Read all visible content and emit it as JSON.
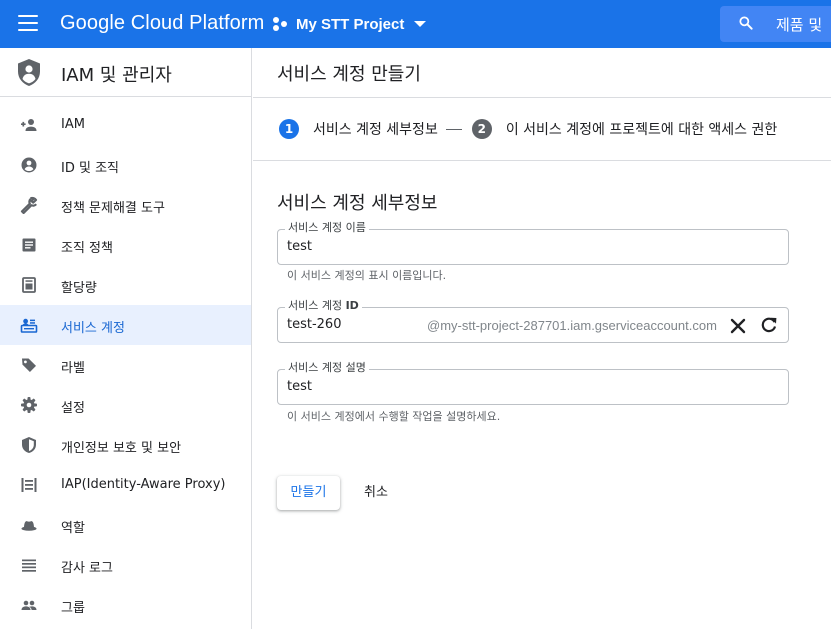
{
  "topbar": {
    "brand": "Google Cloud Platform",
    "project_name": "My STT Project",
    "search_placeholder": "제품 및"
  },
  "sidebar": {
    "title": "IAM 및 관리자",
    "items": [
      {
        "label": "IAM",
        "icon": "person-add-icon"
      },
      {
        "label": "ID 및 조직",
        "icon": "account-circle-icon"
      },
      {
        "label": "정책 문제해결 도구",
        "icon": "wrench-icon"
      },
      {
        "label": "조직 정책",
        "icon": "article-icon"
      },
      {
        "label": "할당량",
        "icon": "quota-icon"
      },
      {
        "label": "서비스 계정",
        "icon": "service-account-icon",
        "active": true
      },
      {
        "label": "라벨",
        "icon": "label-tag-icon"
      },
      {
        "label": "설정",
        "icon": "settings-gear-icon"
      },
      {
        "label": "개인정보 보호 및 보안",
        "icon": "privacy-shield-icon"
      },
      {
        "label": "IAP(Identity-Aware Proxy)",
        "icon": "iap-icon"
      },
      {
        "label": "역할",
        "icon": "roles-hat-icon"
      },
      {
        "label": "감사 로그",
        "icon": "list-icon"
      },
      {
        "label": "그룹",
        "icon": "group-icon"
      }
    ]
  },
  "main": {
    "page_title": "서비스 계정 만들기",
    "steps": [
      {
        "number": "1",
        "label": "서비스 계정 세부정보",
        "active": true
      },
      {
        "number": "2",
        "label": "이 서비스 계정에 프로젝트에 대한 액세스 권한",
        "active": false
      }
    ],
    "section_title": "서비스 계정 세부정보",
    "fields": {
      "name": {
        "label": "서비스 계정 이름",
        "value": "test",
        "hint": "이 서비스 계정의 표시 이름입니다."
      },
      "id": {
        "label_prefix": "서비스 계정 ",
        "label_bold": "ID",
        "value": "test-260",
        "suffix": "@my-stt-project-287701.iam.gserviceaccount.com"
      },
      "description": {
        "label": "서비스 계정 설명",
        "value": "test",
        "hint": "이 서비스 계정에서 수행할 작업을 설명하세요."
      }
    },
    "buttons": {
      "create": "만들기",
      "cancel": "취소"
    }
  },
  "colors": {
    "brand_blue": "#1a73e8",
    "active_bg": "#e8f0fe",
    "active_text": "#1967d2"
  }
}
